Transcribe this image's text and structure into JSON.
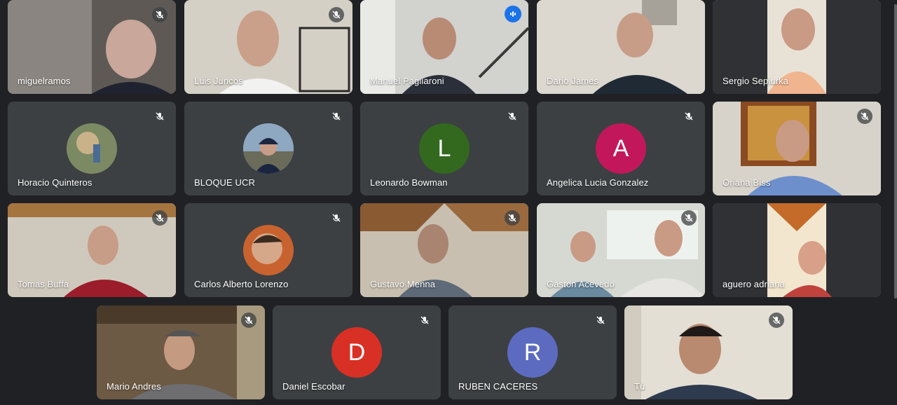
{
  "participants": [
    {
      "name": "miguelramos",
      "state": "muted",
      "bg": "#6b6560"
    },
    {
      "name": "Luis Juncos",
      "state": "muted",
      "bg": "#d8d4cc"
    },
    {
      "name": "Manuel Pagliaroni",
      "state": "speaking",
      "bg": "#cfcfcc"
    },
    {
      "name": "Dario James",
      "state": "none",
      "bg": "#d9d6cd"
    },
    {
      "name": "Sergio Sepiurka",
      "state": "none",
      "bg": "#e7e3da"
    },
    {
      "name": "Horacio Quinteros",
      "state": "muted",
      "avatar": "photo",
      "avatar_color": "#6a7b58"
    },
    {
      "name": "BLOQUE UCR",
      "state": "muted",
      "avatar": "photo",
      "avatar_color": "#6f8fae"
    },
    {
      "name": "Leonardo Bowman",
      "state": "muted",
      "avatar": "L",
      "avatar_color": "#33691e"
    },
    {
      "name": "Angelica Lucia Gonzalez",
      "state": "muted",
      "avatar": "A",
      "avatar_color": "#c2185b"
    },
    {
      "name": "Oriana Biss",
      "state": "muted",
      "bg": "#d7d2c9"
    },
    {
      "name": "Tomas Buffa",
      "state": "muted",
      "bg": "#c8c3b6"
    },
    {
      "name": "Carlos Alberto Lorenzo",
      "state": "muted",
      "avatar": "photo",
      "avatar_color": "#b3592d"
    },
    {
      "name": "Gustavo Menna",
      "state": "muted",
      "bg": "#b59c7e"
    },
    {
      "name": "Gaston Acevedo",
      "state": "muted",
      "bg": "#cfd2c9"
    },
    {
      "name": "aguero adriana",
      "state": "none",
      "bg": "#e9c9a0"
    },
    {
      "name": "Mario Andres",
      "state": "muted",
      "bg": "#7d6a55"
    },
    {
      "name": "Daniel Escobar",
      "state": "muted",
      "avatar": "D",
      "avatar_color": "#d93025"
    },
    {
      "name": "RUBEN CACERES",
      "state": "muted",
      "avatar": "R",
      "avatar_color": "#5c6bc0"
    },
    {
      "name": "Tú",
      "state": "muted",
      "bg": "#e6e1d7"
    }
  ]
}
